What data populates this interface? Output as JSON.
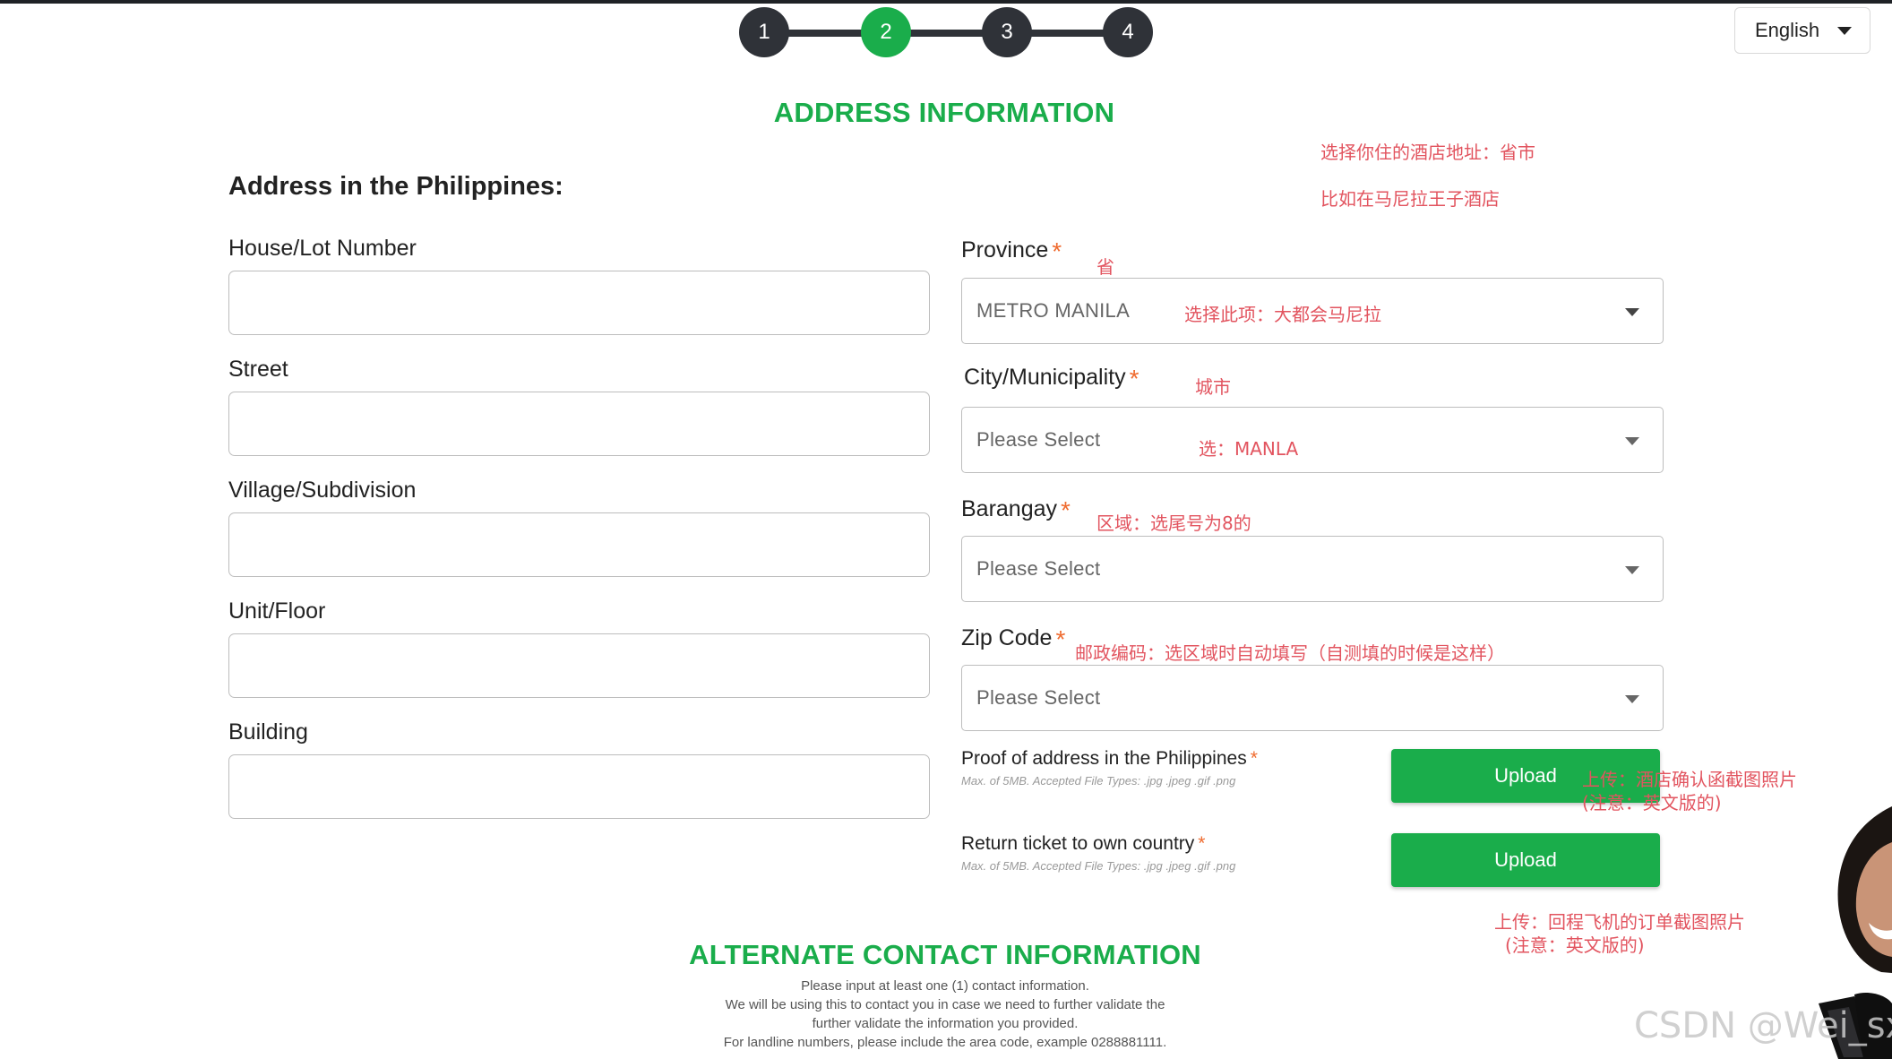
{
  "stepper": {
    "steps": [
      "1",
      "2",
      "3",
      "4"
    ],
    "active_step": "2"
  },
  "language": {
    "selected": "English"
  },
  "address_section": {
    "title": "ADDRESS INFORMATION",
    "subheading": "Address in the Philippines:"
  },
  "left_fields": [
    {
      "label": "House/Lot Number",
      "value": ""
    },
    {
      "label": "Street",
      "value": ""
    },
    {
      "label": "Village/Subdivision",
      "value": ""
    },
    {
      "label": "Unit/Floor",
      "value": ""
    },
    {
      "label": "Building",
      "value": ""
    }
  ],
  "province": {
    "label": "Province",
    "required_mark": "*",
    "value": "METRO MANILA"
  },
  "city": {
    "label": "City/Municipality",
    "required_mark": "*",
    "placeholder": "Please Select"
  },
  "barangay": {
    "label": "Barangay",
    "required_mark": "*",
    "placeholder": "Please Select"
  },
  "zip": {
    "label": "Zip Code",
    "required_mark": "*",
    "placeholder": "Please Select"
  },
  "uploads": [
    {
      "label": "Proof of address  in the Philippines",
      "required_mark": "*",
      "hint": "Max. of 5MB. Accepted File Types: .jpg .jpeg .gif .png",
      "button": "Upload"
    },
    {
      "label": "Return ticket to own country",
      "required_mark": "*",
      "hint": "Max. of 5MB. Accepted File Types: .jpg .jpeg .gif .png",
      "button": "Upload"
    }
  ],
  "contact_section": {
    "title": "ALTERNATE CONTACT INFORMATION",
    "lines": [
      "Please input at least one (1) contact information.",
      "We will be using this to contact you in case we need to further validate the",
      "further validate the information you provided.",
      "For landline numbers, please include the area code, example 0288881111."
    ]
  },
  "annotations": {
    "hotel_address": "选择你住的酒店地址：省市",
    "hotel_example": "比如在马尼拉王子酒店",
    "province_cn": "省",
    "province_pick": "选择此项：大都会马尼拉",
    "city_cn": "城市",
    "city_pick": "选：MANLA",
    "barangay_cn": "区域：选尾号为8的",
    "zip_cn": "邮政编码：选区域时自动填写（自测填的时候是这样）",
    "upload1_a": "上传：酒店确认函截图照片",
    "upload1_b": "(注意：英文版的)",
    "upload2_a": "上传：回程飞机的订单截图照片",
    "upload2_b": "(注意：英文版的)"
  },
  "watermark": "CSDN @Wei_sx",
  "colors": {
    "accent_green": "#1aad4b",
    "step_dark": "#2f3238",
    "annotation_red": "#e2545f",
    "required_orange": "#ef6b2f"
  }
}
